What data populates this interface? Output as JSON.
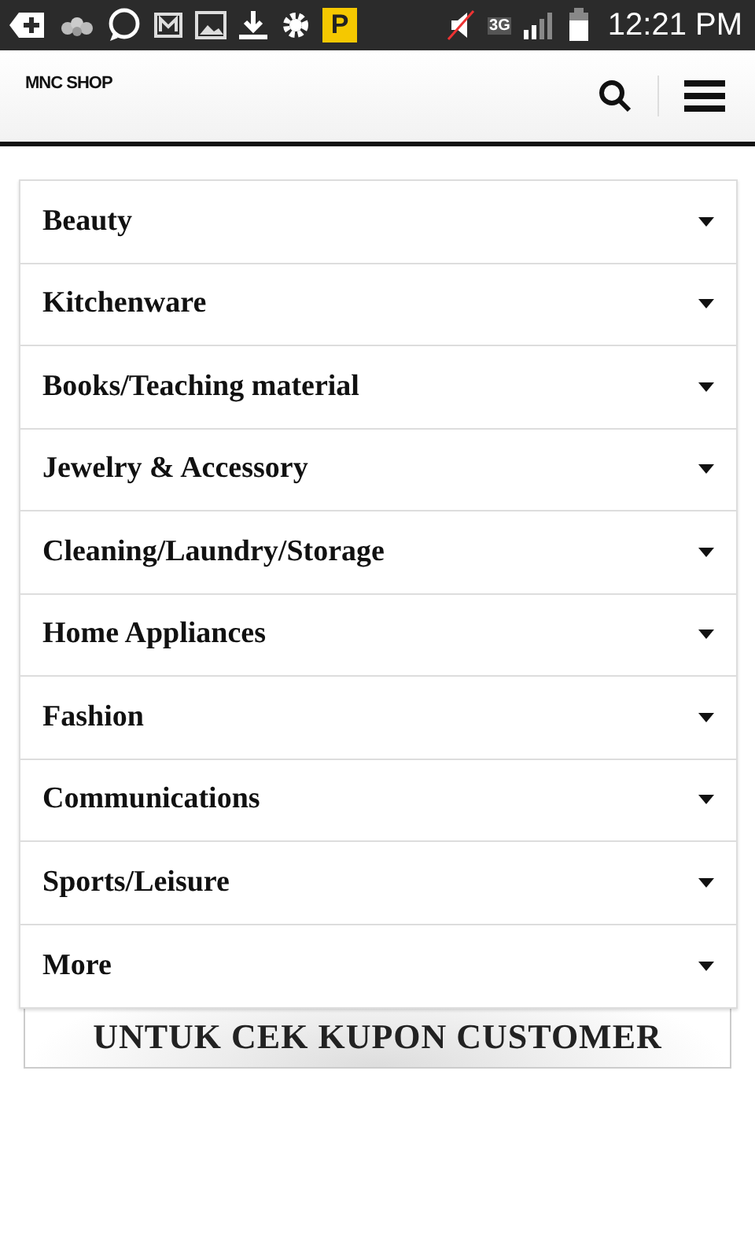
{
  "status_bar": {
    "time": "12:21 PM",
    "network": "3G",
    "parking_badge": "P"
  },
  "header": {
    "logo": "MNC SHOP"
  },
  "menu": {
    "items": [
      {
        "label": "Beauty",
        "expanded": false
      },
      {
        "label": "Kitchenware",
        "expanded": false
      },
      {
        "label": "Books/Teaching material",
        "expanded": false
      },
      {
        "label": "Jewelry & Accessory",
        "expanded": false
      },
      {
        "label": "Cleaning/Laundry/Storage",
        "expanded": false
      },
      {
        "label": "Home Appliances",
        "expanded": false
      },
      {
        "label": "Fashion",
        "expanded": false
      },
      {
        "label": "Communications",
        "expanded": false
      },
      {
        "label": "Sports/Leisure",
        "expanded": false
      },
      {
        "label": "More",
        "expanded": false
      }
    ]
  },
  "banner": {
    "text": "UNTUK CEK KUPON CUSTOMER"
  }
}
